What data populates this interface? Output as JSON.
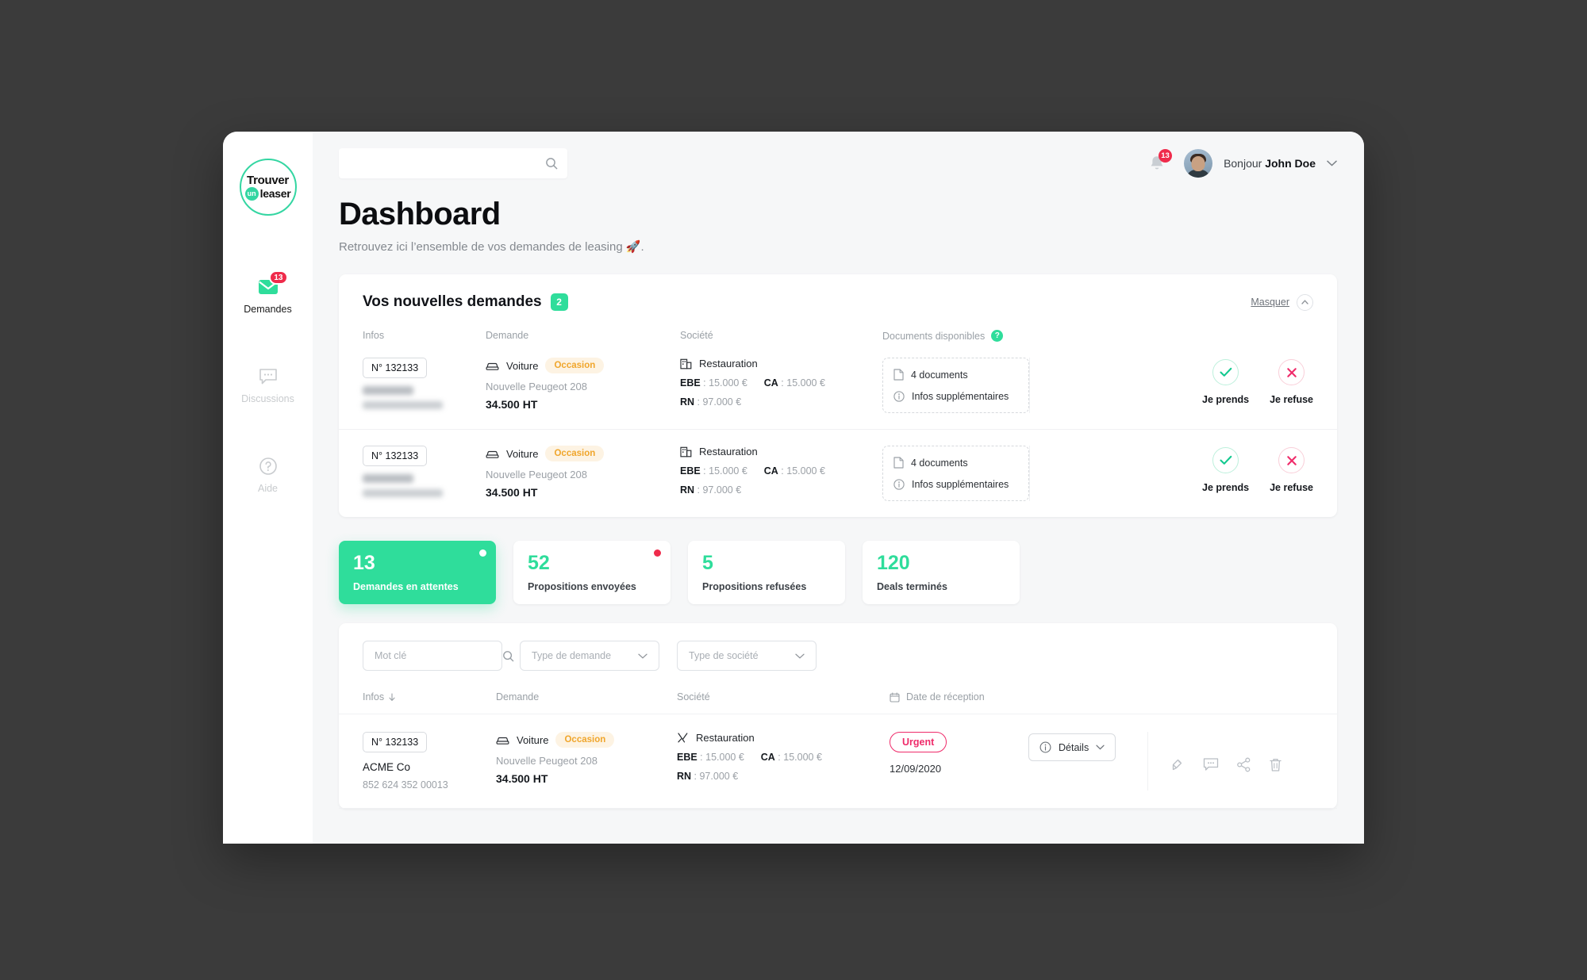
{
  "app": {
    "logo": {
      "line1": "Trouver",
      "badge": "un",
      "line2": "leaser"
    }
  },
  "sidebar": {
    "items": [
      {
        "label": "Demandes",
        "icon": "mail-icon",
        "badge": "13",
        "active": true
      },
      {
        "label": "Discussions",
        "icon": "chat-icon",
        "badge": "",
        "active": false
      },
      {
        "label": "Aide",
        "icon": "help-circle-icon",
        "badge": "",
        "active": false
      }
    ]
  },
  "topbar": {
    "search_placeholder": "",
    "search_value": "",
    "notifications_count": "13",
    "greeting_prefix": "Bonjour",
    "user_name": "John Doe"
  },
  "page": {
    "title": "Dashboard",
    "subtitle": "Retrouvez ici l’ensemble de vos demandes de leasing 🚀."
  },
  "new_demands": {
    "title": "Vos nouvelles demandes",
    "count": "2",
    "hide_label": "Masquer",
    "columns": {
      "infos": "Infos",
      "demande": "Demande",
      "societe": "Société",
      "documents": "Documents disponibles",
      "documents_help": "?"
    },
    "rows": [
      {
        "number": "N° 132133",
        "company_masked": true,
        "demande_type": "Voiture",
        "demande_tag": "Occasion",
        "demande_model": "Nouvelle Peugeot 208",
        "demande_price": "34.500 HT",
        "societe_sector": "Restauration",
        "ebe_label": "EBE",
        "ebe_value": "15.000 €",
        "ca_label": "CA",
        "ca_value": "15.000 €",
        "rn_label": "RN",
        "rn_value": "97.000 €",
        "documents_count": "4 documents",
        "documents_extra": "Infos supplémentaires",
        "accept_label": "Je prends",
        "refuse_label": "Je refuse"
      },
      {
        "number": "N° 132133",
        "company_masked": true,
        "demande_type": "Voiture",
        "demande_tag": "Occasion",
        "demande_model": "Nouvelle Peugeot 208",
        "demande_price": "34.500 HT",
        "societe_sector": "Restauration",
        "ebe_label": "EBE",
        "ebe_value": "15.000 €",
        "ca_label": "CA",
        "ca_value": "15.000 €",
        "rn_label": "RN",
        "rn_value": "97.000 €",
        "documents_count": "4 documents",
        "documents_extra": "Infos supplémentaires",
        "accept_label": "Je prends",
        "refuse_label": "Je refuse"
      }
    ]
  },
  "stats": [
    {
      "value": "13",
      "label": "Demandes en attentes",
      "highlight": true,
      "dot": "white"
    },
    {
      "value": "52",
      "label": "Propositions envoyées",
      "highlight": false,
      "dot": "red"
    },
    {
      "value": "5",
      "label": "Propositions refusées",
      "highlight": false,
      "dot": "none"
    },
    {
      "value": "120",
      "label": "Deals terminés",
      "highlight": false,
      "dot": "none"
    }
  ],
  "filters": {
    "keyword_placeholder": "Mot clé",
    "keyword_value": "",
    "type_demande": "Type de demande",
    "type_societe": "Type de société"
  },
  "table": {
    "columns": {
      "infos": "Infos",
      "demande": "Demande",
      "societe": "Société",
      "date": "Date de réception"
    },
    "rows": [
      {
        "number": "N° 132133",
        "company": "ACME Co",
        "company_id": "852 624 352 00013",
        "demande_type": "Voiture",
        "demande_tag": "Occasion",
        "demande_model": "Nouvelle Peugeot 208",
        "demande_price": "34.500 HT",
        "societe_sector": "Restauration",
        "ebe_label": "EBE",
        "ebe_value": "15.000 €",
        "ca_label": "CA",
        "ca_value": "15.000 €",
        "rn_label": "RN",
        "rn_value": "97.000 €",
        "status": "Urgent",
        "date": "12/09/2020",
        "details_label": "Détails"
      }
    ]
  },
  "colors": {
    "accent_green": "#2fdd9b",
    "danger_red": "#ef2b4b",
    "urgent_pink": "#ef2b6a",
    "tag_orange": "#f0a62c",
    "page_bg": "#f6f7f8",
    "desktop_bg": "#3b3b3b"
  }
}
